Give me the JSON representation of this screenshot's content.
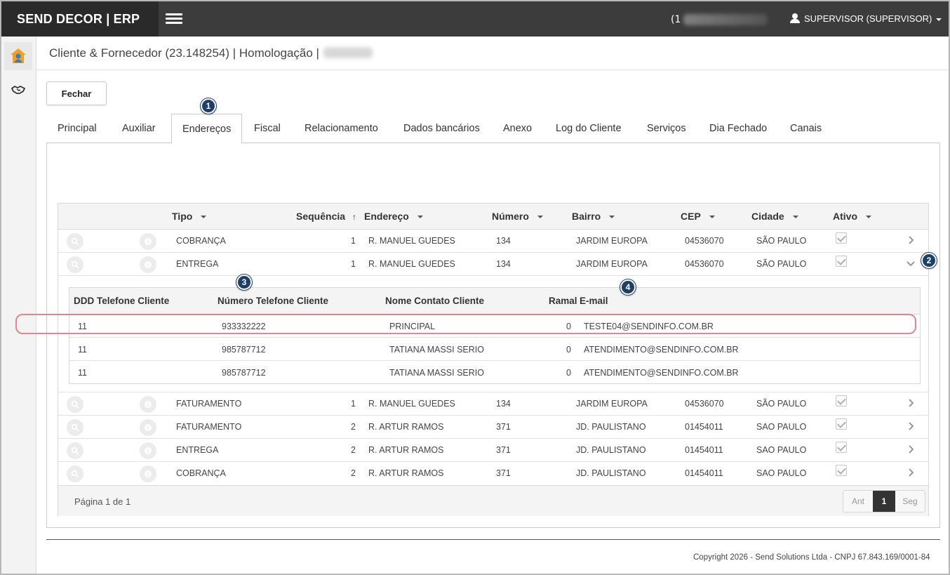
{
  "app": {
    "brand": "SEND DECOR | ERP",
    "phone_prefix": "(1"
  },
  "user": {
    "label": "SUPERVISOR (SUPERVISOR)"
  },
  "page": {
    "title": "Cliente & Fornecedor (23.148254) | Homologação |"
  },
  "actions": {
    "close_label": "Fechar"
  },
  "tabs": [
    "Principal",
    "Auxiliar",
    "Endereços",
    "Fiscal",
    "Relacionamento",
    "Dados bancários",
    "Anexo",
    "Log do Cliente",
    "Serviços",
    "Dia Fechado",
    "Canais"
  ],
  "active_tab": "Endereços",
  "grid": {
    "headers": {
      "tipo": "Tipo",
      "sequencia": "Sequência",
      "endereco": "Endereço",
      "numero": "Número",
      "bairro": "Bairro",
      "cep": "CEP",
      "cidade": "Cidade",
      "ativo": "Ativo"
    },
    "rows": [
      {
        "tipo": "COBRANÇA",
        "seq": "1",
        "endereco": "R. MANUEL GUEDES",
        "numero": "134",
        "bairro": "JARDIM EUROPA",
        "cep": "04536070",
        "cidade": "SÃO PAULO"
      },
      {
        "tipo": "ENTREGA",
        "seq": "1",
        "endereco": "R. MANUEL GUEDES",
        "numero": "134",
        "bairro": "JARDIM EUROPA",
        "cep": "04536070",
        "cidade": "SÃO PAULO"
      },
      {
        "tipo": "FATURAMENTO",
        "seq": "1",
        "endereco": "R. MANUEL GUEDES",
        "numero": "134",
        "bairro": "JARDIM EUROPA",
        "cep": "04536070",
        "cidade": "SÃO PAULO"
      },
      {
        "tipo": "FATURAMENTO",
        "seq": "2",
        "endereco": "R. ARTUR RAMOS",
        "numero": "371",
        "bairro": "JD. PAULISTANO",
        "cep": "01454011",
        "cidade": "SAO PAULO"
      },
      {
        "tipo": "ENTREGA",
        "seq": "2",
        "endereco": "R. ARTUR RAMOS",
        "numero": "371",
        "bairro": "JD. PAULISTANO",
        "cep": "01454011",
        "cidade": "SAO PAULO"
      },
      {
        "tipo": "COBRANÇA",
        "seq": "2",
        "endereco": "R. ARTUR RAMOS",
        "numero": "371",
        "bairro": "JD. PAULISTANO",
        "cep": "01454011",
        "cidade": "SAO PAULO"
      }
    ],
    "footer": "Página 1 de 1",
    "pager": {
      "prev": "Ant",
      "current": "1",
      "next": "Seg"
    }
  },
  "subgrid": {
    "headers": {
      "ddd": "DDD Telefone Cliente",
      "numero": "Número Telefone Cliente",
      "contato": "Nome Contato Cliente",
      "ramal": "Ramal",
      "email": "E-mail"
    },
    "rows": [
      {
        "ddd": "11",
        "numero": "933332222",
        "contato": "PRINCIPAL",
        "ramal": "0",
        "email": "TESTE04@SENDINFO.COM.BR"
      },
      {
        "ddd": "11",
        "numero": "985787712",
        "contato": "TATIANA MASSI SERIO",
        "ramal": "0",
        "email": "ATENDIMENTO@SENDINFO.COM.BR"
      },
      {
        "ddd": "11",
        "numero": "985787712",
        "contato": "TATIANA MASSI SERIO",
        "ramal": "0",
        "email": "ATENDIMENTO@SENDINFO.COM.BR"
      }
    ]
  },
  "callouts": [
    "1",
    "2",
    "3",
    "4"
  ],
  "copyright": "Copyright 2026 - Send Solutions Ltda - CNPJ 67.843.169/0001-84",
  "colors": {
    "topbar": "#3c3c3c",
    "brand_bg": "#2a2a2a",
    "callout": "#1f3f6b",
    "highlight": "#e8838a"
  }
}
